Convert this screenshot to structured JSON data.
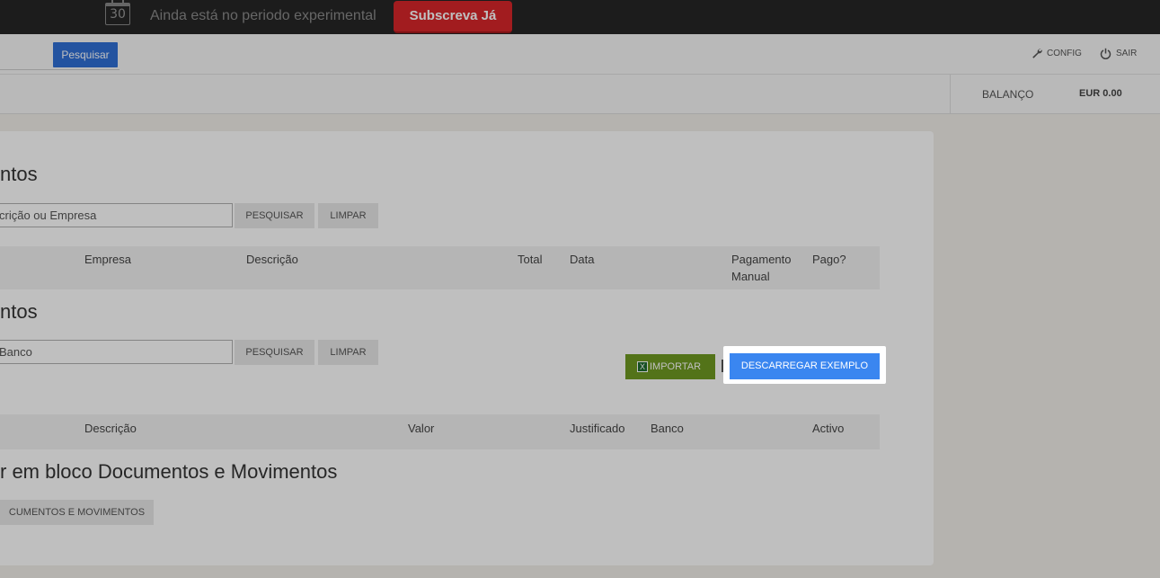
{
  "trial_bar": {
    "calendar_day": "30",
    "message": "Ainda está no periodo experimental",
    "subscribe_label": "Subscreva Já"
  },
  "nav": {
    "search_button": "Pesquisar",
    "config_label": "CONFIG",
    "logout_label": "SAIR"
  },
  "balance": {
    "label": "BALANÇO",
    "value": "EUR 0.00"
  },
  "documents": {
    "title": "ntos",
    "search_value": "crição ou Empresa",
    "search_button": "PESQUISAR",
    "clear_button": "LIMPAR",
    "columns": [
      "Empresa",
      "Descrição",
      "Total",
      "Data",
      "Pagamento Manual",
      "Pago?"
    ]
  },
  "movements": {
    "title": "ntos",
    "search_value": "Banco",
    "search_button": "PESQUISAR",
    "clear_button": "LIMPAR",
    "import_button": "IMPORTAR",
    "download_example_button": "DESCARREGAR EXEMPLO",
    "columns": [
      "Descrição",
      "Valor",
      "Justificado",
      "Banco",
      "Activo"
    ]
  },
  "bulk": {
    "title": "r em bloco Documentos e Movimentos",
    "button": "CUMENTOS E MOVIMENTOS"
  },
  "colors": {
    "trial_bar": "#262626",
    "subscribe": "#d9262a",
    "primary": "#2f6fd6",
    "download": "#3a86f0",
    "import": "#6f9a22"
  }
}
